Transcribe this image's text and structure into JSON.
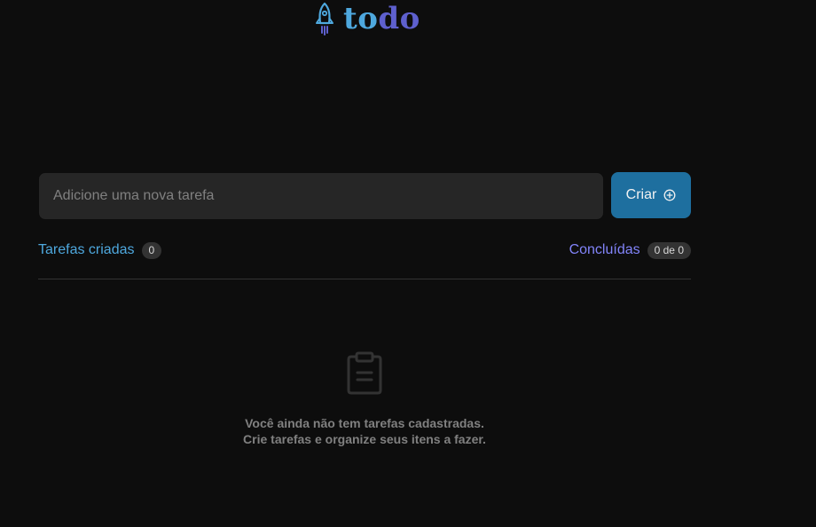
{
  "header": {
    "logo_icon": "rocket-icon",
    "logo_text_part1": "to",
    "logo_text_part2": "do"
  },
  "new_task": {
    "placeholder": "Adicione uma nova tarefa",
    "value": "",
    "create_label": "Criar",
    "create_icon": "plus-circle-icon"
  },
  "stats": {
    "created_label": "Tarefas criadas",
    "created_count": "0",
    "done_label": "Concluídas",
    "done_count": "0 de 0"
  },
  "empty": {
    "icon": "clipboard-icon",
    "line1": "Você ainda não tem tarefas cadastradas.",
    "line2": "Crie tarefas e organize seus itens a fazer."
  },
  "colors": {
    "background": "#0d0d0d",
    "input_bg": "#262626",
    "blue": "#4ea8de",
    "blue_dark": "#1e6f9f",
    "purple": "#8284fa",
    "purple_dark": "#5e60ce",
    "badge_bg": "#333333",
    "muted": "#808080"
  }
}
